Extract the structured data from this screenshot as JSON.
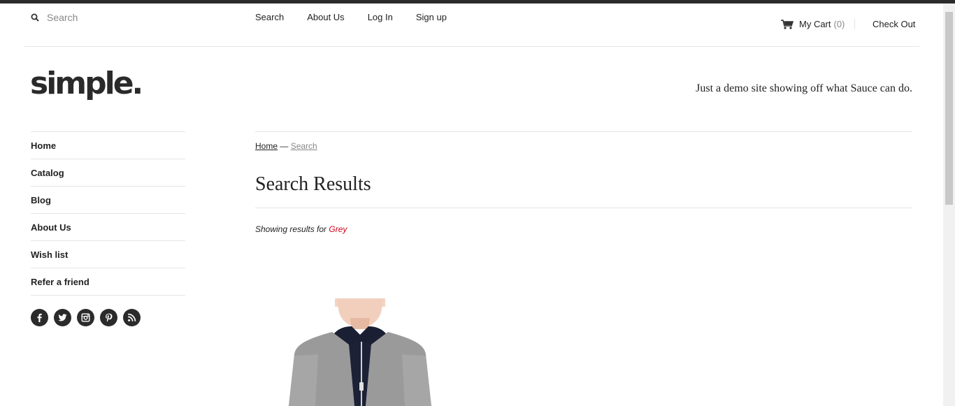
{
  "header": {
    "search_placeholder": "Search",
    "nav": [
      {
        "label": "Search"
      },
      {
        "label": "About Us"
      },
      {
        "label": "Log In"
      },
      {
        "label": "Sign up"
      }
    ],
    "cart_label": "My Cart",
    "cart_count": "(0)",
    "checkout_label": "Check Out"
  },
  "brand": {
    "logo": "simple.",
    "tagline": "Just a demo site showing off what Sauce can do."
  },
  "sidebar": {
    "items": [
      {
        "label": "Home"
      },
      {
        "label": "Catalog"
      },
      {
        "label": "Blog"
      },
      {
        "label": "About Us"
      },
      {
        "label": "Wish list"
      },
      {
        "label": "Refer a friend"
      }
    ],
    "social_icons": [
      "facebook-icon",
      "twitter-icon",
      "instagram-icon",
      "pinterest-icon",
      "rss-icon"
    ]
  },
  "main": {
    "breadcrumb": {
      "home": "Home",
      "separator": "—",
      "current": "Search"
    },
    "title": "Search Results",
    "results_prefix": "Showing results for",
    "search_term": "Grey"
  },
  "colors": {
    "accent_red": "#d0021b",
    "dark": "#2b2b2b",
    "rule": "#e5e5e5"
  }
}
